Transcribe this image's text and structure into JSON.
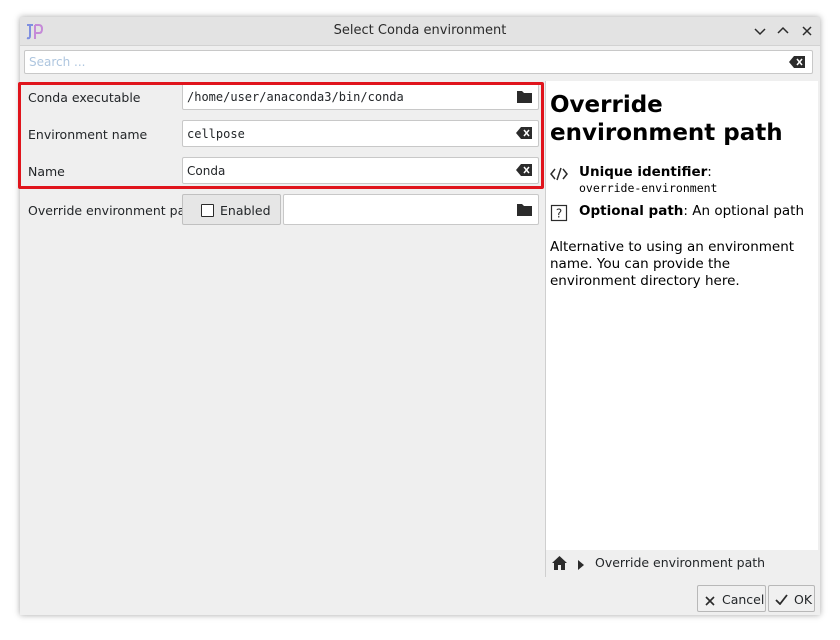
{
  "window": {
    "title": "Select Conda environment"
  },
  "search": {
    "placeholder": "Search ..."
  },
  "form": {
    "fields": [
      {
        "label": "Conda executable",
        "value": "/home/user/anaconda3/bin/conda"
      },
      {
        "label": "Environment name",
        "value": "cellpose"
      },
      {
        "label": "Name",
        "value": "Conda"
      }
    ],
    "override": {
      "label": "Override environment path",
      "toggle_label": "Enabled",
      "value": ""
    }
  },
  "doc": {
    "title": "Override environment path",
    "unique_id_label": "Unique identifier",
    "unique_id_value": "override-environment",
    "optional_label": "Optional path",
    "optional_desc": ": An optional path",
    "description": "Alternative to using an environment name. You can provide the environment directory here."
  },
  "breadcrumb": {
    "current": "Override environment path"
  },
  "buttons": {
    "cancel": "Cancel",
    "ok": "OK"
  },
  "colors": {
    "highlight": "#e0141c",
    "placeholder": "#aec6df",
    "window_bg": "#efefef"
  },
  "icons": [
    "app-logo-icon",
    "minimize-icon",
    "maximize-icon",
    "close-icon",
    "clear-text-icon",
    "folder-icon",
    "code-icon",
    "question-icon",
    "home-icon",
    "chevron-right-icon",
    "x-icon",
    "checkmark-icon"
  ]
}
